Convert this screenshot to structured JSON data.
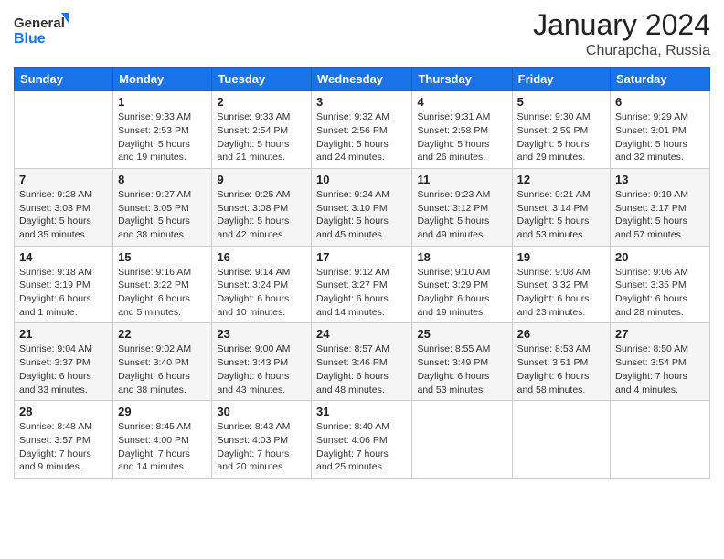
{
  "logo": {
    "line1": "General",
    "line2": "Blue"
  },
  "title": "January 2024",
  "location": "Churapcha, Russia",
  "weekdays": [
    "Sunday",
    "Monday",
    "Tuesday",
    "Wednesday",
    "Thursday",
    "Friday",
    "Saturday"
  ],
  "weeks": [
    [
      {
        "day": "",
        "info": ""
      },
      {
        "day": "1",
        "info": "Sunrise: 9:33 AM\nSunset: 2:53 PM\nDaylight: 5 hours\nand 19 minutes."
      },
      {
        "day": "2",
        "info": "Sunrise: 9:33 AM\nSunset: 2:54 PM\nDaylight: 5 hours\nand 21 minutes."
      },
      {
        "day": "3",
        "info": "Sunrise: 9:32 AM\nSunset: 2:56 PM\nDaylight: 5 hours\nand 24 minutes."
      },
      {
        "day": "4",
        "info": "Sunrise: 9:31 AM\nSunset: 2:58 PM\nDaylight: 5 hours\nand 26 minutes."
      },
      {
        "day": "5",
        "info": "Sunrise: 9:30 AM\nSunset: 2:59 PM\nDaylight: 5 hours\nand 29 minutes."
      },
      {
        "day": "6",
        "info": "Sunrise: 9:29 AM\nSunset: 3:01 PM\nDaylight: 5 hours\nand 32 minutes."
      }
    ],
    [
      {
        "day": "7",
        "info": "Sunrise: 9:28 AM\nSunset: 3:03 PM\nDaylight: 5 hours\nand 35 minutes."
      },
      {
        "day": "8",
        "info": "Sunrise: 9:27 AM\nSunset: 3:05 PM\nDaylight: 5 hours\nand 38 minutes."
      },
      {
        "day": "9",
        "info": "Sunrise: 9:25 AM\nSunset: 3:08 PM\nDaylight: 5 hours\nand 42 minutes."
      },
      {
        "day": "10",
        "info": "Sunrise: 9:24 AM\nSunset: 3:10 PM\nDaylight: 5 hours\nand 45 minutes."
      },
      {
        "day": "11",
        "info": "Sunrise: 9:23 AM\nSunset: 3:12 PM\nDaylight: 5 hours\nand 49 minutes."
      },
      {
        "day": "12",
        "info": "Sunrise: 9:21 AM\nSunset: 3:14 PM\nDaylight: 5 hours\nand 53 minutes."
      },
      {
        "day": "13",
        "info": "Sunrise: 9:19 AM\nSunset: 3:17 PM\nDaylight: 5 hours\nand 57 minutes."
      }
    ],
    [
      {
        "day": "14",
        "info": "Sunrise: 9:18 AM\nSunset: 3:19 PM\nDaylight: 6 hours\nand 1 minute."
      },
      {
        "day": "15",
        "info": "Sunrise: 9:16 AM\nSunset: 3:22 PM\nDaylight: 6 hours\nand 5 minutes."
      },
      {
        "day": "16",
        "info": "Sunrise: 9:14 AM\nSunset: 3:24 PM\nDaylight: 6 hours\nand 10 minutes."
      },
      {
        "day": "17",
        "info": "Sunrise: 9:12 AM\nSunset: 3:27 PM\nDaylight: 6 hours\nand 14 minutes."
      },
      {
        "day": "18",
        "info": "Sunrise: 9:10 AM\nSunset: 3:29 PM\nDaylight: 6 hours\nand 19 minutes."
      },
      {
        "day": "19",
        "info": "Sunrise: 9:08 AM\nSunset: 3:32 PM\nDaylight: 6 hours\nand 23 minutes."
      },
      {
        "day": "20",
        "info": "Sunrise: 9:06 AM\nSunset: 3:35 PM\nDaylight: 6 hours\nand 28 minutes."
      }
    ],
    [
      {
        "day": "21",
        "info": "Sunrise: 9:04 AM\nSunset: 3:37 PM\nDaylight: 6 hours\nand 33 minutes."
      },
      {
        "day": "22",
        "info": "Sunrise: 9:02 AM\nSunset: 3:40 PM\nDaylight: 6 hours\nand 38 minutes."
      },
      {
        "day": "23",
        "info": "Sunrise: 9:00 AM\nSunset: 3:43 PM\nDaylight: 6 hours\nand 43 minutes."
      },
      {
        "day": "24",
        "info": "Sunrise: 8:57 AM\nSunset: 3:46 PM\nDaylight: 6 hours\nand 48 minutes."
      },
      {
        "day": "25",
        "info": "Sunrise: 8:55 AM\nSunset: 3:49 PM\nDaylight: 6 hours\nand 53 minutes."
      },
      {
        "day": "26",
        "info": "Sunrise: 8:53 AM\nSunset: 3:51 PM\nDaylight: 6 hours\nand 58 minutes."
      },
      {
        "day": "27",
        "info": "Sunrise: 8:50 AM\nSunset: 3:54 PM\nDaylight: 7 hours\nand 4 minutes."
      }
    ],
    [
      {
        "day": "28",
        "info": "Sunrise: 8:48 AM\nSunset: 3:57 PM\nDaylight: 7 hours\nand 9 minutes."
      },
      {
        "day": "29",
        "info": "Sunrise: 8:45 AM\nSunset: 4:00 PM\nDaylight: 7 hours\nand 14 minutes."
      },
      {
        "day": "30",
        "info": "Sunrise: 8:43 AM\nSunset: 4:03 PM\nDaylight: 7 hours\nand 20 minutes."
      },
      {
        "day": "31",
        "info": "Sunrise: 8:40 AM\nSunset: 4:06 PM\nDaylight: 7 hours\nand 25 minutes."
      },
      {
        "day": "",
        "info": ""
      },
      {
        "day": "",
        "info": ""
      },
      {
        "day": "",
        "info": ""
      }
    ]
  ]
}
